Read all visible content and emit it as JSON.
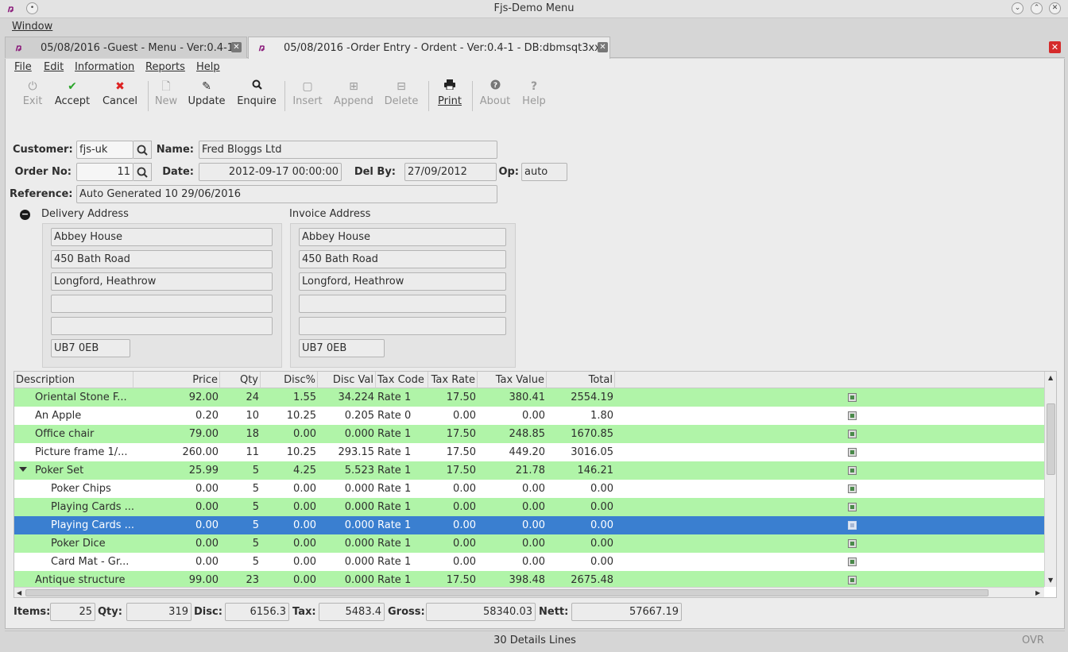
{
  "window": {
    "title": "Fjs-Demo Menu",
    "logo_text": "ꬻ",
    "btn_min": "⌄",
    "btn_max": "⌃",
    "btn_close": "✕",
    "btn_sticky": "•"
  },
  "window_menu": {
    "label": "Window"
  },
  "tabs": [
    {
      "label": "05/08/2016 -Guest - Menu - Ver:0.4-1"
    },
    {
      "label": "05/08/2016 -Order Entry - Ordent - Ver:0.4-1 - DB:dbmsqt3xx"
    }
  ],
  "menu": [
    "File",
    "Edit",
    "Information",
    "Reports",
    "Help"
  ],
  "toolbar": [
    {
      "label": "Exit",
      "icon": "power-icon",
      "enabled": false
    },
    {
      "label": "Accept",
      "icon": "check-icon",
      "enabled": true
    },
    {
      "label": "Cancel",
      "icon": "x-icon",
      "enabled": true
    },
    {
      "label": "New",
      "icon": "new-doc-icon",
      "enabled": false
    },
    {
      "label": "Update",
      "icon": "pencil-icon",
      "enabled": true
    },
    {
      "label": "Enquire",
      "icon": "search-icon",
      "enabled": true
    },
    {
      "label": "Insert",
      "icon": "square-icon",
      "enabled": false
    },
    {
      "label": "Append",
      "icon": "plus-square-icon",
      "enabled": false
    },
    {
      "label": "Delete",
      "icon": "minus-square-icon",
      "enabled": false
    },
    {
      "label": "Print",
      "icon": "printer-icon",
      "enabled": true
    },
    {
      "label": "About",
      "icon": "question-circle-icon",
      "enabled": false
    },
    {
      "label": "Help",
      "icon": "question-icon",
      "enabled": false
    }
  ],
  "form": {
    "customer_label": "Customer:",
    "customer": "fjs-uk",
    "name_label": "Name:",
    "name": "Fred Bloggs Ltd",
    "order_no_label": "Order No:",
    "order_no": "11",
    "date_label": "Date:",
    "date": "2012-09-17 00:00:00",
    "del_by_label": "Del By:",
    "del_by": "27/09/2012",
    "op_label": "Op:",
    "op": "auto",
    "reference_label": "Reference:",
    "reference": "Auto Generated 10 29/06/2016"
  },
  "delivery": {
    "title": "Delivery Address",
    "lines": [
      "Abbey House",
      "450 Bath Road",
      "Longford, Heathrow",
      "",
      ""
    ],
    "postcode": "UB7 0EB"
  },
  "invoice": {
    "title": "Invoice Address",
    "lines": [
      "Abbey House",
      "450 Bath Road",
      "Longford, Heathrow",
      "",
      ""
    ],
    "postcode": "UB7 0EB"
  },
  "grid": {
    "headers": [
      "Description",
      "Price",
      "Qty",
      "Disc%",
      "Disc Val",
      "Tax Code",
      "Tax Rate",
      "Tax Value",
      "Total"
    ],
    "rows": [
      {
        "desc": "Oriental Stone F...",
        "price": "92.00",
        "qty": "24",
        "disc_pct": "1.55",
        "disc_val": "34.224",
        "tax_code": "Rate 1",
        "tax_rate": "17.50",
        "tax_value": "380.41",
        "total": "2554.19",
        "style": "green",
        "level": 0
      },
      {
        "desc": "An Apple",
        "price": "0.20",
        "qty": "10",
        "disc_pct": "10.25",
        "disc_val": "0.205",
        "tax_code": "Rate 0",
        "tax_rate": "0.00",
        "tax_value": "0.00",
        "total": "1.80",
        "style": "white",
        "level": 0
      },
      {
        "desc": "Office chair",
        "price": "79.00",
        "qty": "18",
        "disc_pct": "0.00",
        "disc_val": "0.000",
        "tax_code": "Rate 1",
        "tax_rate": "17.50",
        "tax_value": "248.85",
        "total": "1670.85",
        "style": "green",
        "level": 0
      },
      {
        "desc": "Picture frame 1/...",
        "price": "260.00",
        "qty": "11",
        "disc_pct": "10.25",
        "disc_val": "293.15",
        "tax_code": "Rate 1",
        "tax_rate": "17.50",
        "tax_value": "449.20",
        "total": "3016.05",
        "style": "white",
        "level": 0
      },
      {
        "desc": "Poker Set",
        "price": "25.99",
        "qty": "5",
        "disc_pct": "4.25",
        "disc_val": "5.523",
        "tax_code": "Rate 1",
        "tax_rate": "17.50",
        "tax_value": "21.78",
        "total": "146.21",
        "style": "green",
        "level": 0,
        "expanded": true
      },
      {
        "desc": "Poker Chips",
        "price": "0.00",
        "qty": "5",
        "disc_pct": "0.00",
        "disc_val": "0.000",
        "tax_code": "Rate 1",
        "tax_rate": "0.00",
        "tax_value": "0.00",
        "total": "0.00",
        "style": "white",
        "level": 1
      },
      {
        "desc": "Playing Cards ...",
        "price": "0.00",
        "qty": "5",
        "disc_pct": "0.00",
        "disc_val": "0.000",
        "tax_code": "Rate 1",
        "tax_rate": "0.00",
        "tax_value": "0.00",
        "total": "0.00",
        "style": "green",
        "level": 1
      },
      {
        "desc": "Playing Cards ...",
        "price": "0.00",
        "qty": "5",
        "disc_pct": "0.00",
        "disc_val": "0.000",
        "tax_code": "Rate 1",
        "tax_rate": "0.00",
        "tax_value": "0.00",
        "total": "0.00",
        "style": "selected",
        "level": 1
      },
      {
        "desc": "Poker Dice",
        "price": "0.00",
        "qty": "5",
        "disc_pct": "0.00",
        "disc_val": "0.000",
        "tax_code": "Rate 1",
        "tax_rate": "0.00",
        "tax_value": "0.00",
        "total": "0.00",
        "style": "green",
        "level": 1
      },
      {
        "desc": "Card Mat - Gr...",
        "price": "0.00",
        "qty": "5",
        "disc_pct": "0.00",
        "disc_val": "0.000",
        "tax_code": "Rate 1",
        "tax_rate": "0.00",
        "tax_value": "0.00",
        "total": "0.00",
        "style": "white",
        "level": 1
      },
      {
        "desc": "Antique structure",
        "price": "99.00",
        "qty": "23",
        "disc_pct": "0.00",
        "disc_val": "0.000",
        "tax_code": "Rate 1",
        "tax_rate": "17.50",
        "tax_value": "398.48",
        "total": "2675.48",
        "style": "green",
        "level": 0
      }
    ]
  },
  "totals": {
    "items_label": "Items:",
    "items": "25",
    "qty_label": "Qty:",
    "qty": "319",
    "disc_label": "Disc:",
    "disc": "6156.3",
    "tax_label": "Tax:",
    "tax": "5483.4",
    "gross_label": "Gross:",
    "gross": "58340.03",
    "nett_label": "Nett:",
    "nett": "57667.19"
  },
  "status": {
    "message": "30 Details Lines",
    "mode": "OVR"
  },
  "colors": {
    "row_green": "#b0f4a8",
    "row_selected": "#3a7fd0",
    "close_red": "#d52a2a",
    "logo": "#8a1a7a"
  }
}
